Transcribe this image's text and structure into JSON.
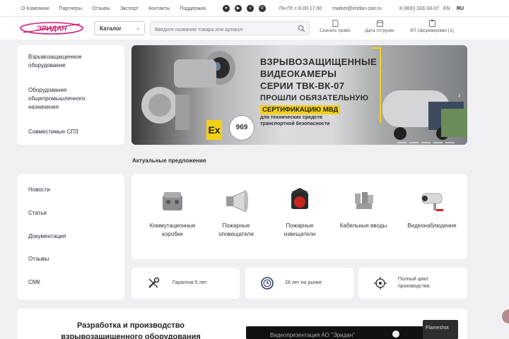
{
  "topbar": {
    "nav": [
      "О Компании",
      "Партнеры",
      "Отзывы",
      "Экспорт",
      "Контакты",
      "Поддержка"
    ],
    "socials": [
      {
        "name": "telegram-icon",
        "glyph": "➤"
      },
      {
        "name": "youtube-icon",
        "glyph": "▶"
      },
      {
        "name": "vk-icon",
        "glyph": "v"
      },
      {
        "name": "whatsapp-icon",
        "glyph": "✆"
      }
    ],
    "hours": "Пн-Пт с 8.00-17.00",
    "email": "market@eridan-zao.ru",
    "phone": "8 (800) 333-33-07",
    "lang_en": "EN",
    "lang_ru": "RU"
  },
  "header": {
    "logo_text": "ЭРИДАН",
    "catalog_label": "Каталог",
    "search_placeholder": "Введите название товара или артикул",
    "links": [
      {
        "label": "Скачать прайс",
        "icon": "document-icon"
      },
      {
        "label": "Дата отгрузки",
        "icon": "calendar-icon"
      },
      {
        "label": "КП сформирован (1)",
        "icon": "clipboard-icon"
      }
    ]
  },
  "sidebar_top": {
    "items": [
      {
        "label": "Взрывозащищенное оборудование"
      },
      {
        "label": "Оборудование общепромышленного назначения"
      },
      {
        "label": "Совместимые СПЗ"
      }
    ]
  },
  "banner": {
    "line1": "ВЗРЫВОЗАЩИЩЕННЫЕ",
    "line2": "ВИДЕОКАМЕРЫ",
    "line3": "СЕРИИ ТВК-ВК-07",
    "line4": "ПРОШЛИ ОБЯЗАТЕЛЬНУЮ",
    "cert": "СЕРТИФИКАЦИЮ МВД",
    "sub1": "для технических средств",
    "sub2": "транспортной безопасности",
    "ex_mark": "Ex",
    "badge": "969"
  },
  "section_title": "Актуальные предложения",
  "sidebar_bottom": {
    "items": [
      {
        "label": "Новости"
      },
      {
        "label": "Статьи"
      },
      {
        "label": "Документация"
      },
      {
        "label": "Отзывы"
      },
      {
        "label": "СМК"
      }
    ]
  },
  "products": [
    {
      "label": "Коммутационные коробки"
    },
    {
      "label": "Пожарные оповещатели"
    },
    {
      "label": "Пожарные извещатели"
    },
    {
      "label": "Кабельные вводы"
    },
    {
      "label": "Видеонаблюдение"
    }
  ],
  "features": [
    {
      "label": "Гарантия 5 лет",
      "icon": "tools-icon"
    },
    {
      "label": "28 лет на рынке",
      "icon": "clock-badge-icon"
    },
    {
      "label": "Полный цикл производства",
      "icon": "target-icon"
    }
  ],
  "bottom": {
    "heading": "Разработка и производство взрывозащищенного оборудования",
    "video_title": "Видеопрезентация АО \"Эридан\""
  },
  "flameshot": "Flameshot",
  "colors": {
    "brand": "#d6197a",
    "accent_yellow": "#f2d017",
    "background": "#f0f0f3"
  }
}
